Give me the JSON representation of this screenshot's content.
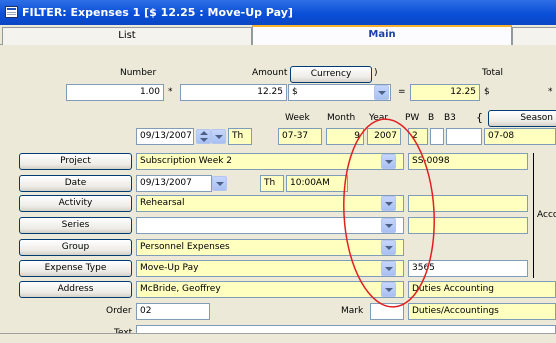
{
  "window": {
    "title": "FILTER: Expenses  1 [$ 12.25 : Move-Up Pay]"
  },
  "tabs": [
    {
      "label": "List"
    },
    {
      "label": "Main"
    }
  ],
  "top_row": {
    "number_label": "Number",
    "number_value": "1.00",
    "amount_label": "Amount",
    "amount_value": "12.25",
    "currency_button": "Currency",
    "currency_symbol": "$",
    "total_label": "Total",
    "total_value": "12.25",
    "total_symbol": "$",
    "mult_sign": "*",
    "eq_sign": "=",
    "tail_sign": "*"
  },
  "date_row": {
    "week_label": "Week",
    "month_label": "Month",
    "year_label": "Year",
    "pw_label": "PW",
    "b_label": "B",
    "b3_label": "B3",
    "season_button": "Season",
    "date_value": "09/13/2007",
    "day_value": "Th",
    "week_value": "07-37",
    "month_value": "9",
    "year_value": "2007",
    "pw_value": "2",
    "season_value": "07-08"
  },
  "form": {
    "project_button": "Project",
    "project_value": "Subscription Week  2",
    "project_code": "SS-0098",
    "date_button": "Date",
    "date_value": "09/13/2007",
    "date_day": "Th",
    "date_time": "10:00AM",
    "activity_button": "Activity",
    "activity_value": "Rehearsal",
    "series_button": "Series",
    "series_value": "",
    "group_button": "Group",
    "group_value": "Personnel Expenses",
    "expense_type_button": "Expense Type",
    "expense_type_value": "Move-Up Pay",
    "expense_code": "3565",
    "address_button": "Address",
    "address_value": "McBride, Geoffrey",
    "address_dept": "Duties Accounting",
    "order_label": "Order",
    "order_value": "02",
    "mark_label": "Mark",
    "mark_dept": "Duties/Accountings",
    "text_label": "Text",
    "side_label": "Acco"
  },
  "annotation": {
    "color": "#e02020"
  }
}
